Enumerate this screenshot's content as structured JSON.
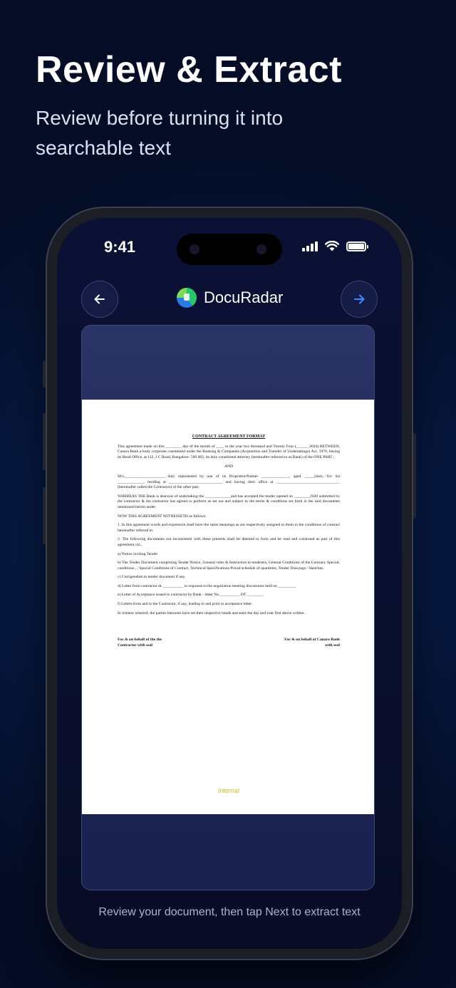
{
  "headline": "Review & Extract",
  "subheadline": "Review before turning it into searchable text",
  "status_bar": {
    "time": "9:41"
  },
  "app": {
    "brand_name": "DocuRadar"
  },
  "document": {
    "title": "CONTRACT AGREEMENT FORMAT",
    "paragraphs": [
      "This agreement made on this ________ day of the month of ____ in the year two thousand and Twenty Four (______ 2024) BETWEEN, Canara Bank a body corporate constituted under the Banking & Companies (Acquisition and Transfer of Undertakings) Act, 1970, having its Head Office, at 112, J C Road, Bangalore- 560 002, its duly constituted attorney (hereinafter referred to as Bank) of the ONE PART ;",
      "AND",
      "M/s.____________________ duly represented by one of its Proprietor/Partner ______________, aged _____years, S/o Sri _____________, residing at ___________________________ and having their office at ________________________________ (hereinafter called the Contractor) of the other part.",
      "WHEREAS THE Bank is desirous of undertaking the _____________and has accepted the tender opened on ________2020 submitted by the contractor & the contractor has agreed to perform as set out and subject to the terms & conditions set forth in the said documents mentioned herein under.",
      "NOW THIS AGREEMENT WITNESSETH as follows:",
      "1. In this agreement words and expression shall have the same meanings as are respectively assigned to them in the conditions of contract hereinafter referred to.",
      "2. The following documents not inconsistent with these presents shall be deemed to form and be read and construed as part of this agreement viz.,",
      "a) Notice inviting Tender",
      "b) The Tender Document comprising Tender Notice, General rules & Instruction to tenderers, General Conditions of the Contract, Special; conditions , , Special Conditions of Contract, Technical Specifications Priced schedule of quantities, Tender Drawings / Sketches.",
      "c) Corrigendum to tender document if any.",
      "d) Letter from contractor dt. __________ in response to the negotiation meeting discussions held on _________",
      "e) Letter of Acceptance issued to contractor by Bank - letter No.__________ DT ________.",
      "f) Letters from and to the Contractor, if any, leading to and prior to acceptance letter.",
      "In witness whereof, the parties hereunto have set their respective hands and seals the day and year first above written."
    ],
    "signature_left": "For & on behalf of the the Contractor with seal",
    "signature_right": "For & on behalf of Canara Bank with seal",
    "watermark": "Internal"
  },
  "hint": "Review your document, then tap Next to extract text",
  "colors": {
    "accent": "#3d8bff",
    "background": "#050d26"
  },
  "icons": {
    "back": "arrow-left-icon",
    "next": "arrow-right-icon"
  }
}
